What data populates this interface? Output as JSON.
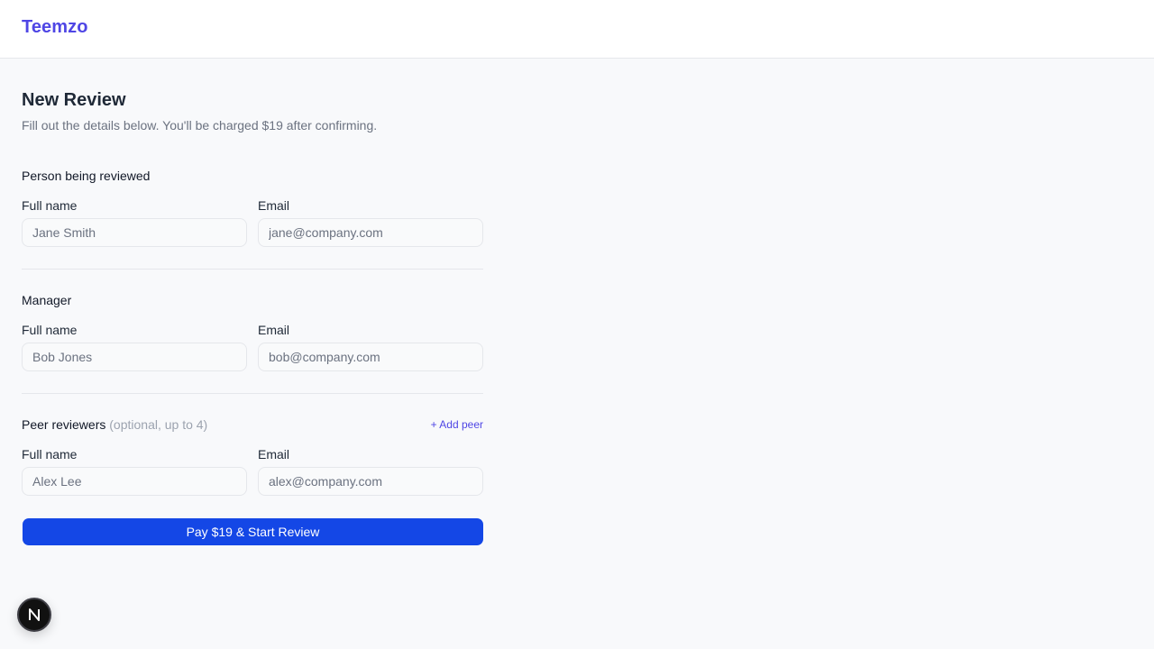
{
  "header": {
    "brand": "Teemzo"
  },
  "page": {
    "title": "New Review",
    "subtitle": "Fill out the details below. You'll be charged $19 after confirming."
  },
  "sections": {
    "person": {
      "title": "Person being reviewed",
      "name_label": "Full name",
      "name_placeholder": "Jane Smith",
      "email_label": "Email",
      "email_placeholder": "jane@company.com"
    },
    "manager": {
      "title": "Manager",
      "name_label": "Full name",
      "name_placeholder": "Bob Jones",
      "email_label": "Email",
      "email_placeholder": "bob@company.com"
    },
    "peers": {
      "title": "Peer reviewers",
      "note": "(optional, up to 4)",
      "add_label": "+ Add peer",
      "name_label": "Full name",
      "name_placeholder": "Alex Lee",
      "email_label": "Email",
      "email_placeholder": "alex@company.com"
    }
  },
  "actions": {
    "pay_label": "Pay $19 & Start Review"
  },
  "badge": {
    "letter": "N",
    "icon": "nextjs-logo-icon"
  },
  "colors": {
    "brand": "#4f46e5",
    "primary": "#1447e6",
    "background": "#f8f9fb"
  }
}
